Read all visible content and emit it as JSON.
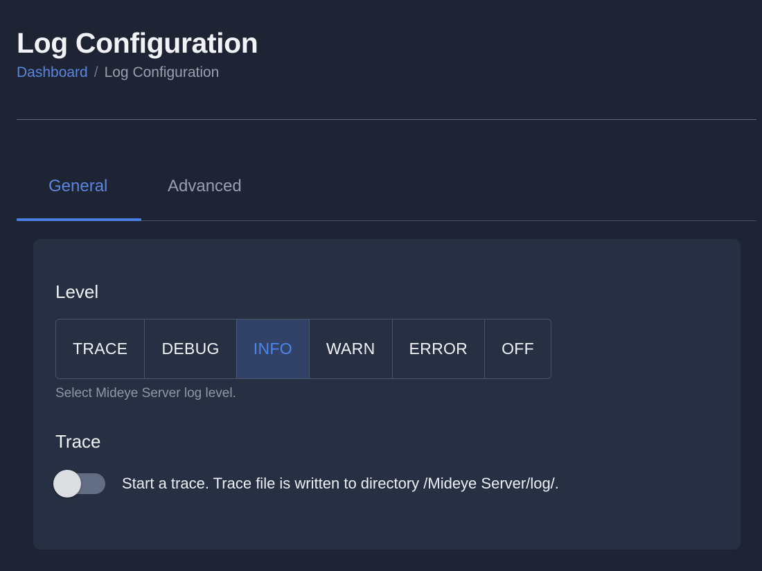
{
  "header": {
    "title": "Log Configuration",
    "breadcrumb": {
      "root": "Dashboard",
      "separator": "/",
      "current": "Log Configuration"
    }
  },
  "tabs": {
    "items": [
      {
        "label": "General",
        "active": true
      },
      {
        "label": "Advanced",
        "active": false
      }
    ]
  },
  "card": {
    "level": {
      "heading": "Level",
      "options": [
        "TRACE",
        "DEBUG",
        "INFO",
        "WARN",
        "ERROR",
        "OFF"
      ],
      "selected": "INFO",
      "helper_text": "Select Mideye Server log level."
    },
    "trace": {
      "heading": "Trace",
      "toggle_state": "off",
      "description": "Start a trace. Trace file is written to directory /Mideye Server/log/."
    }
  },
  "colors": {
    "page_background": "#1e2433",
    "card_background": "#272f42",
    "accent_blue": "#4a7de0",
    "link_blue": "#5b86e0",
    "selected_segment_background": "#324267",
    "selected_segment_text": "#4a86f0",
    "muted_text": "#8f97a8",
    "primary_text": "#f1f3f7",
    "border": "#4b5469",
    "switch_track_off": "#636d83",
    "switch_knob": "#dcdee2"
  }
}
